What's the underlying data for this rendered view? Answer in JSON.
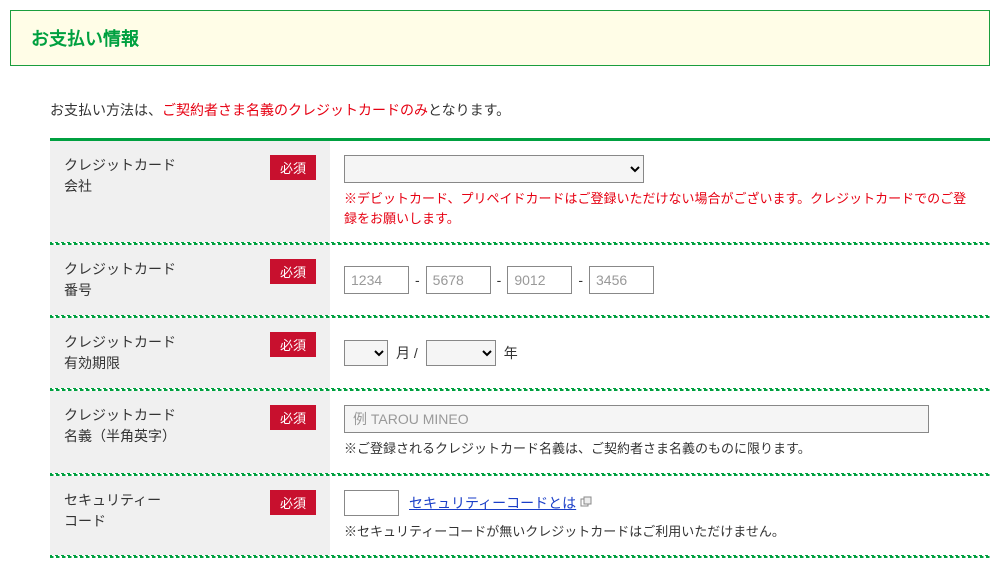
{
  "header": {
    "title": "お支払い情報"
  },
  "payment_note": {
    "prefix": "お支払い方法は、",
    "highlighted": "ご契約者さま名義のクレジットカードのみ",
    "suffix": "となります。"
  },
  "badges": {
    "required": "必須"
  },
  "rows": {
    "company": {
      "label": "クレジットカード会社",
      "note": "※デビットカード、プリペイドカードはご登録いただけない場合がございます。クレジットカードでのご登録をお願いします。"
    },
    "number": {
      "label": "クレジットカード番号",
      "ph1": "1234",
      "ph2": "5678",
      "ph3": "9012",
      "ph4": "3456",
      "separator": "-"
    },
    "expiry": {
      "label": "クレジットカード有効期限",
      "month_suffix": "月 /",
      "year_suffix": "年"
    },
    "name": {
      "label": "クレジットカード名義（半角英字）",
      "placeholder": "例 TAROU MINEO",
      "note": "※ご登録されるクレジットカード名義は、ご契約者さま名義のものに限ります。"
    },
    "security": {
      "label": "セキュリティーコード",
      "link_text": "セキュリティーコードとは",
      "note": "※セキュリティーコードが無いクレジットカードはご利用いただけません。"
    }
  }
}
